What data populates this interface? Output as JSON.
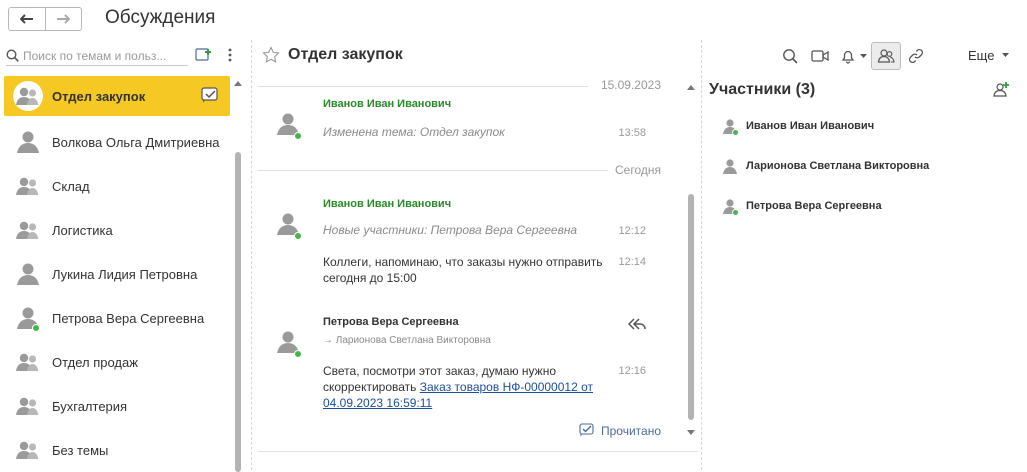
{
  "window": {
    "title": "Обсуждения"
  },
  "search": {
    "placeholder": "Поиск по темам и польз..."
  },
  "conversations": [
    {
      "label": "Отдел закупок",
      "active": true,
      "icon": "group-icon"
    },
    {
      "label": "Волкова Ольга Дмитриевна",
      "icon": "user-icon"
    },
    {
      "label": "Склад",
      "icon": "group-icon"
    },
    {
      "label": "Логистика",
      "icon": "group-icon"
    },
    {
      "label": "Лукина Лидия Петровна",
      "icon": "user-icon"
    },
    {
      "label": "Петрова Вера Сергеевна",
      "icon": "user-icon",
      "online": true
    },
    {
      "label": "Отдел продаж",
      "icon": "group-icon"
    },
    {
      "label": "Бухгалтерия",
      "icon": "group-icon"
    },
    {
      "label": "Без темы",
      "icon": "group-icon"
    }
  ],
  "chat": {
    "title": "Отдел закупок",
    "date1": "15.09.2023",
    "date2": "Сегодня",
    "messages": [
      {
        "author": "Иванов Иван Иванович",
        "system": "Изменена тема: Отдел закупок",
        "time": "13:58"
      },
      {
        "author": "Иванов Иван Иванович",
        "system": "Новые участники: Петрова Вера Сергеевна",
        "system_time": "12:12",
        "text": "Коллеги, напоминаю, что заказы нужно отправить сегодня до 15:00",
        "time": "12:14"
      },
      {
        "author": "Петрова Вера Сергеевна",
        "forwarded": "→ Ларионова Светлана Викторовна",
        "text": "Света, посмотри этот заказ, думаю нужно скорректировать ",
        "link": "Заказ товаров НФ-00000012 от 04.09.2023 16:59:11",
        "time": "12:16"
      }
    ],
    "read_status": "Прочитано"
  },
  "toolbar": {
    "more_label": "Еще"
  },
  "participants": {
    "title": "Участники (3)",
    "items": [
      {
        "name": "Иванов Иван Иванович",
        "online": true
      },
      {
        "name": "Ларионова Светлана Викторовна",
        "online": false
      },
      {
        "name": "Петрова Вера Сергеевна",
        "online": true
      }
    ]
  },
  "colors": {
    "accent": "#f6c823",
    "author_green": "#2a8a2a",
    "online": "#43b74a",
    "link": "#1d4e9b"
  }
}
